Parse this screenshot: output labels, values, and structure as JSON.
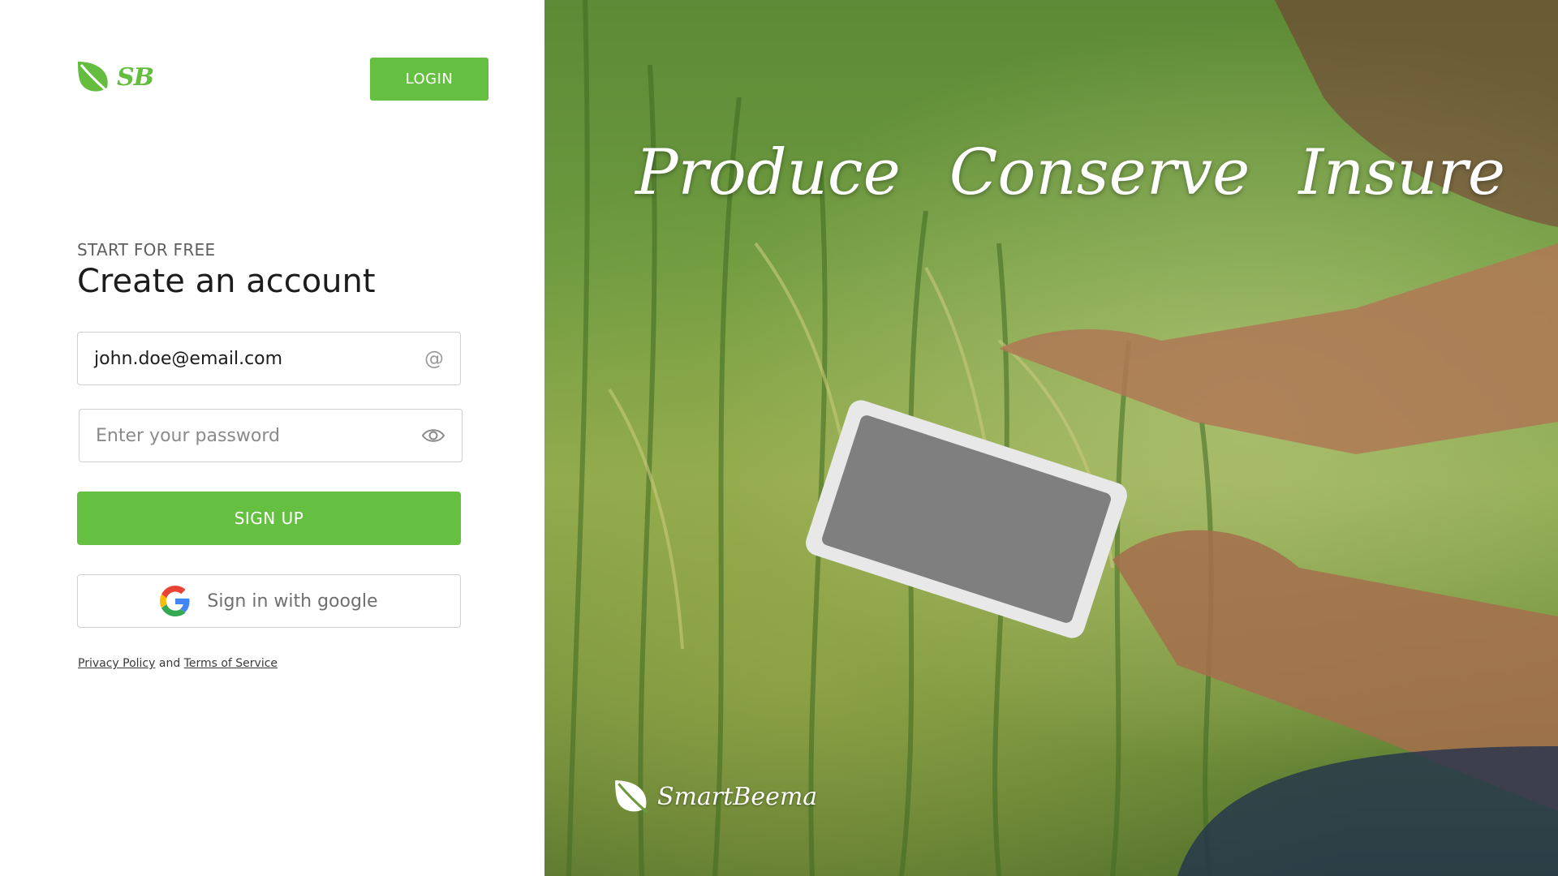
{
  "app": {
    "logo_text": "SB",
    "brand_name": "SmartBeema"
  },
  "header": {
    "login_label": "LOGIN"
  },
  "form": {
    "subtitle": "START FOR FREE",
    "title": "Create an account",
    "email_value": "john.doe@email.com",
    "email_icon": "@",
    "password_placeholder": "Enter your password",
    "signup_label": "SIGN UP",
    "google_label": "Sign in with google"
  },
  "legal": {
    "privacy_label": "Privacy Policy",
    "and": "and",
    "terms_label": "Terms of Service"
  },
  "hero": {
    "taglines": [
      "Produce",
      "Conserve",
      "Insure"
    ]
  },
  "colors": {
    "brand_green": "#65bf41",
    "border": "#cfcfcf"
  },
  "icons": [
    "leaf-logo-icon",
    "at-icon",
    "eye-icon",
    "google-icon",
    "leaf-brand-icon"
  ]
}
